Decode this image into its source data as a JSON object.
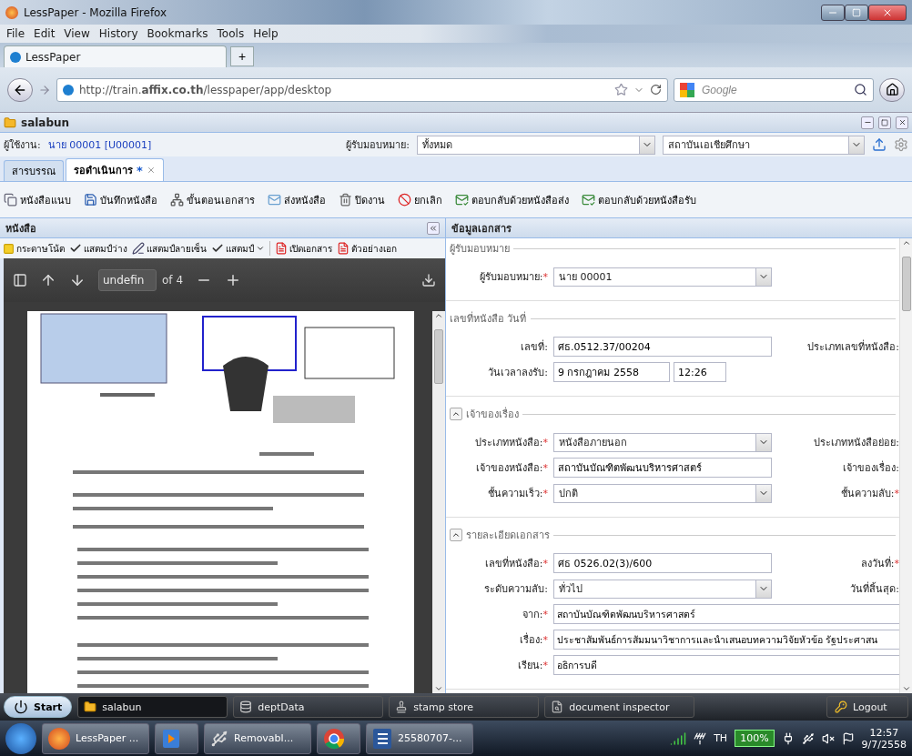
{
  "browser": {
    "title": "LessPaper - Mozilla Firefox",
    "menu": [
      "File",
      "Edit",
      "View",
      "History",
      "Bookmarks",
      "Tools",
      "Help"
    ],
    "tab": "LessPaper",
    "new_tab": "+",
    "url": "http://train.**affix.co.th**/lesspaper/app/desktop",
    "search": {
      "placeholder": "Google"
    }
  },
  "app": {
    "title": "salabun",
    "user_label": "ผู้ใช้งาน:",
    "user": "นาย 00001 [U00001]",
    "assignee_label": "ผู้รับมอบหมาย:",
    "assignee": "ทั้งหมด",
    "org": "สถาบันเอเชียศึกษา"
  },
  "tabs": [
    {
      "label": "สารบรรณ",
      "selected": false
    },
    {
      "label": "รอดำเนินการ",
      "selected": true,
      "modified": "*"
    }
  ],
  "toolbar": [
    {
      "kind": "attach",
      "label": "หนังสือแนบ"
    },
    {
      "kind": "save",
      "label": "บันทึกหนังสือ"
    },
    {
      "kind": "flow",
      "label": "ขั้นตอนเอกสาร"
    },
    {
      "kind": "send",
      "label": "ส่งหนังสือ"
    },
    {
      "kind": "close",
      "label": "ปิดงาน"
    },
    {
      "kind": "cancel",
      "label": "ยกเลิก"
    },
    {
      "kind": "reply",
      "label": "ตอบกลับด้วยหนังสือส่ง"
    },
    {
      "kind": "reply",
      "label": "ตอบกลับด้วยหนังสือรับ"
    }
  ],
  "left_panel": {
    "title": "หนังสือ",
    "doc_toolbar": [
      {
        "kind": "note",
        "label": "กระดาษโน้ต"
      },
      {
        "kind": "check",
        "label": "แสตมป์ว่าง"
      },
      {
        "kind": "sign",
        "label": "แสตมป์ลายเซ็น"
      },
      {
        "kind": "menu",
        "label": "แสตมป์"
      },
      {
        "kind": "pdf",
        "label": "เปิดเอกสาร"
      },
      {
        "kind": "pdf",
        "label": "ตัวอย่างเอก"
      }
    ],
    "viewer": {
      "page": "undefin",
      "of": "of 4"
    }
  },
  "right_panel": {
    "title": "ข้อมูลเอกสาร",
    "sections": [
      {
        "title": "ผู้รับมอบหมาย",
        "rows": [
          {
            "kind": "combo",
            "label": "ผู้รับมอบหมาย:",
            "required": "*",
            "value": "นาย 00001"
          }
        ]
      },
      {
        "title": "เลขที่หนังสือ วันที่",
        "rows": [
          {
            "kind": "text",
            "label": "เลขที่:",
            "value": "ศธ.0512.37/00204",
            "side": "ประเภทเลขที่หนังสือ:"
          },
          {
            "kind": "datetime",
            "label": "วันเวลาลงรับ:",
            "value": "9 กรกฎาคม 2558",
            "time": "12:26"
          }
        ]
      },
      {
        "title": "เจ้าของเรื่อง",
        "expanded": true,
        "rows": [
          {
            "kind": "combo",
            "label": "ประเภทหนังสือ:",
            "required": "*",
            "value": "หนังสือภายนอก",
            "side": "ประเภทหนังสือย่อย:"
          },
          {
            "kind": "text",
            "label": "เจ้าของหนังสือ:",
            "required": "*",
            "value": "สถาบันบัณฑิตพัฒนบริหารศาสตร์",
            "side": "เจ้าของเรื่อง:"
          },
          {
            "kind": "combo",
            "label": "ชั้นความเร็ว:",
            "required": "*",
            "value": "ปกติ",
            "side": "ชั้นความลับ:",
            "side_required": "*"
          }
        ]
      },
      {
        "title": "รายละเอียดเอกสาร",
        "expanded": true,
        "rows": [
          {
            "kind": "text",
            "label": "เลขที่หนังสือ:",
            "required": "*",
            "value": "ศธ 0526.02(3)/600",
            "side": "ลงวันที่:",
            "side_required": "*"
          },
          {
            "kind": "combo",
            "label": "ระดับความลับ:",
            "value": "ทั่วไป",
            "side": "วันที่สิ้นสุด:"
          },
          {
            "kind": "wide",
            "label": "จาก:",
            "required": "*",
            "value": "สถาบันบัณฑิตพัฒนบริหารศาสตร์"
          },
          {
            "kind": "wide",
            "label": "เรื่อง:",
            "required": "*",
            "value": "ประชาสัมพันธ์การสัมมนาวิชาการและนำเสนอบทความวิจัยหัวข้อ รัฐประศาสน"
          },
          {
            "kind": "wide",
            "label": "เรียน:",
            "required": "*",
            "value": "อธิการบดี"
          }
        ]
      }
    ]
  },
  "app_taskbar": {
    "start": "Start",
    "items": [
      {
        "kind": "folder",
        "label": "salabun",
        "selected": true
      },
      {
        "kind": "data",
        "label": "deptData",
        "selected": false
      },
      {
        "kind": "stamp",
        "label": "stamp store",
        "selected": false
      },
      {
        "kind": "inspect",
        "label": "document inspector",
        "selected": false
      }
    ],
    "logout": "Logout"
  },
  "os_taskbar": {
    "items": [
      {
        "kind": "firefox",
        "label": "LessPaper ..."
      },
      {
        "kind": "media"
      },
      {
        "kind": "drive",
        "label": "Removabl..."
      },
      {
        "kind": "chrome"
      },
      {
        "kind": "word",
        "label": "25580707-..."
      }
    ],
    "lang": "TH",
    "battery": "100%",
    "time": "12:57",
    "date": "9/7/2558"
  }
}
